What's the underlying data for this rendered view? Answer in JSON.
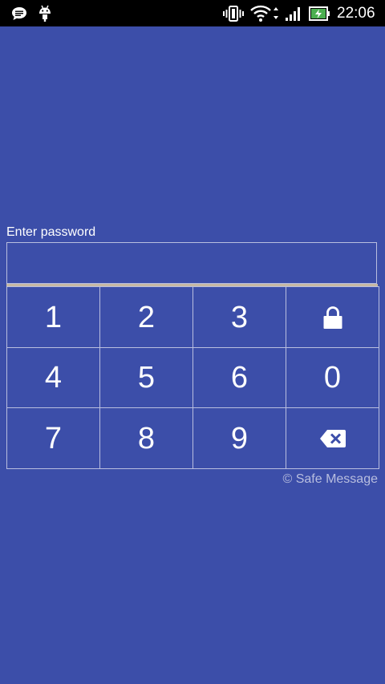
{
  "status_bar": {
    "time": "22:06",
    "icons": [
      "message-icon",
      "android-debug-icon",
      "vibrate-icon",
      "wifi-icon",
      "signal-icon",
      "battery-charging-icon"
    ]
  },
  "password": {
    "label": "Enter password",
    "value": ""
  },
  "keypad": {
    "keys": [
      "1",
      "2",
      "3",
      "4",
      "5",
      "6",
      "0",
      "7",
      "8",
      "9"
    ],
    "lock_icon": "lock-icon",
    "backspace_icon": "backspace-icon"
  },
  "footer": {
    "copyright": "© Safe Message"
  },
  "colors": {
    "background": "#3c4ea9",
    "status_bar": "#000000",
    "grid_line": "#b9bedf",
    "field_underline": "#c7b9a4"
  }
}
